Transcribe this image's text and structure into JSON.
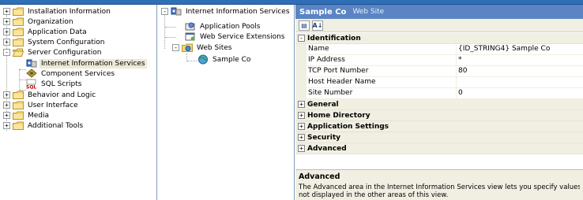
{
  "left_tree": {
    "items": [
      {
        "label": "Installation Information",
        "expander": "+"
      },
      {
        "label": "Organization",
        "expander": "+"
      },
      {
        "label": "Application Data",
        "expander": "+"
      },
      {
        "label": "System Configuration",
        "expander": "+"
      },
      {
        "label": "Server Configuration",
        "expander": "-"
      },
      {
        "label": "Internet Information Services"
      },
      {
        "label": "Component Services"
      },
      {
        "label": "SQL Scripts"
      },
      {
        "label": "Behavior and Logic",
        "expander": "+"
      },
      {
        "label": "User Interface",
        "expander": "+"
      },
      {
        "label": "Media",
        "expander": "+"
      },
      {
        "label": "Additional Tools",
        "expander": "+"
      }
    ]
  },
  "middle_tree": {
    "root": {
      "label": "Internet Information Services",
      "expander": "-"
    },
    "children": [
      {
        "label": "Application Pools"
      },
      {
        "label": "Web Service Extensions"
      },
      {
        "label": "Web Sites",
        "expander": "-"
      },
      {
        "label": "Sample Co"
      }
    ]
  },
  "property_panel": {
    "title": "Sample Co",
    "subtitle": "Web Site",
    "toolbar": {
      "categorized_label": "▤",
      "alphabetical_label": "A↓"
    },
    "categories": [
      {
        "label": "Identification",
        "expander": "-",
        "properties": [
          {
            "name": "Name",
            "value": "{ID_STRING4} Sample Co"
          },
          {
            "name": "IP Address",
            "value": "*"
          },
          {
            "name": "TCP Port Number",
            "value": "80"
          },
          {
            "name": "Host Header Name",
            "value": ""
          },
          {
            "name": "Site Number",
            "value": "0"
          }
        ]
      },
      {
        "label": "General",
        "expander": "+"
      },
      {
        "label": "Home Directory",
        "expander": "+"
      },
      {
        "label": "Application Settings",
        "expander": "+"
      },
      {
        "label": "Security",
        "expander": "+"
      },
      {
        "label": "Advanced",
        "expander": "+"
      }
    ],
    "description": {
      "title": "Advanced",
      "line1": "The Advanced area in the Internet Information Services view lets you specify values fo",
      "line2": "not displayed in the other areas of this view."
    }
  },
  "colors": {
    "title_bar": "#5a84c4",
    "top_strip": "#2f6fb8",
    "grid_gutter": "#f1efe2"
  }
}
